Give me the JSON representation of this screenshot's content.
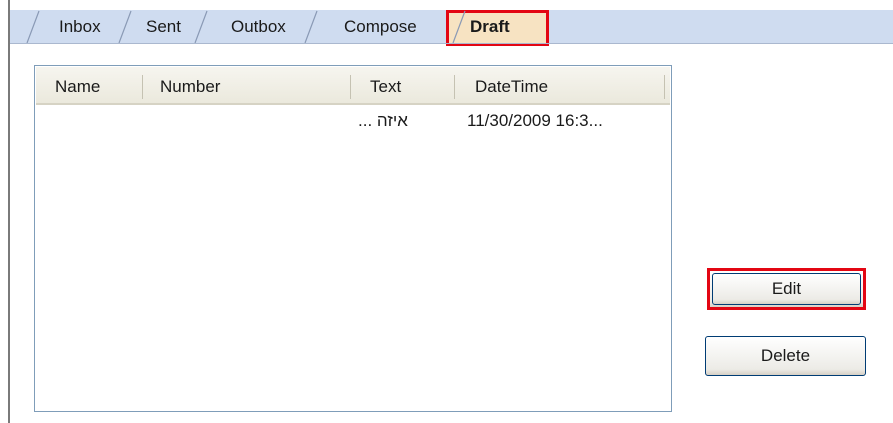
{
  "tabs": [
    {
      "label": "Inbox",
      "active": false
    },
    {
      "label": "Sent",
      "active": false
    },
    {
      "label": "Outbox",
      "active": false
    },
    {
      "label": "Compose",
      "active": false
    },
    {
      "label": "Draft",
      "active": true
    }
  ],
  "list": {
    "columns": [
      "Name",
      "Number",
      "Text",
      "DateTime"
    ],
    "rows": [
      {
        "name": "",
        "number": "",
        "text": "איזה ...",
        "datetime": "11/30/2009 16:3..."
      }
    ]
  },
  "buttons": {
    "edit_label": "Edit",
    "delete_label": "Delete"
  },
  "colors": {
    "tabstrip_bg": "#cfdcf0",
    "active_tab_bg": "#f7e3c2",
    "highlight_outline": "#e30613",
    "list_border": "#7f9db9"
  }
}
